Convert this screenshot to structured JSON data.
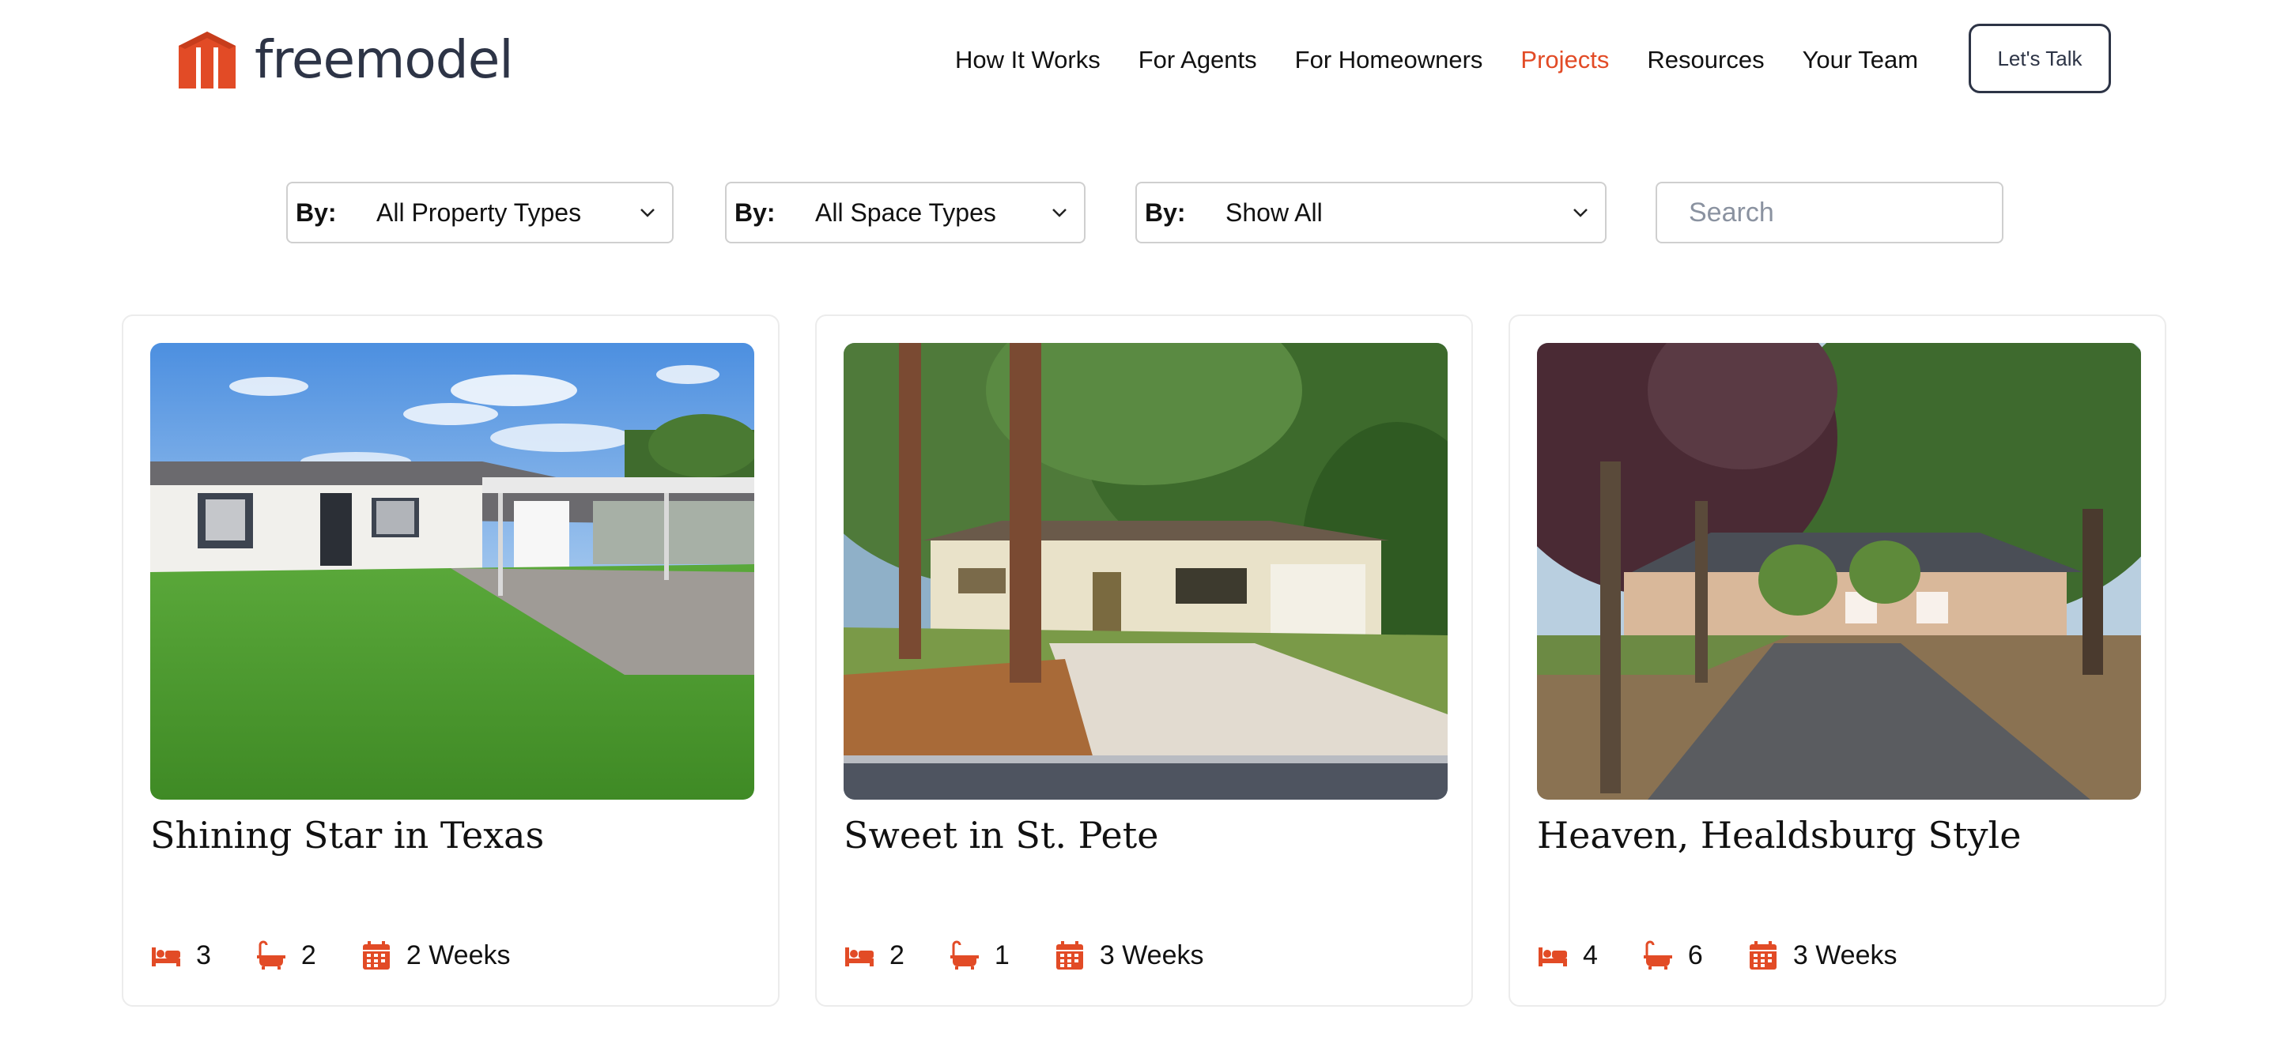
{
  "brand": {
    "name": "freemodel",
    "accent": "#e24b26",
    "dark": "#2d3446"
  },
  "nav": {
    "items": [
      {
        "label": "How It Works"
      },
      {
        "label": "For Agents"
      },
      {
        "label": "For Homeowners"
      },
      {
        "label": "Projects",
        "active": true
      },
      {
        "label": "Resources"
      },
      {
        "label": "Your Team"
      }
    ],
    "cta_label": "Let's Talk"
  },
  "filters": {
    "property": {
      "by": "By:",
      "value": "All Property Types"
    },
    "space": {
      "by": "By:",
      "value": "All Space Types"
    },
    "status": {
      "by": "By:",
      "value": "Show All"
    },
    "search_placeholder": "Search"
  },
  "projects": [
    {
      "title": "Shining Star in Texas",
      "bedrooms": "3",
      "bathrooms": "2",
      "duration": "2 Weeks"
    },
    {
      "title": "Sweet in St. Pete",
      "bedrooms": "2",
      "bathrooms": "1",
      "duration": "3 Weeks"
    },
    {
      "title": "Heaven, Healdsburg Style",
      "bedrooms": "4",
      "bathrooms": "6",
      "duration": "3 Weeks"
    }
  ],
  "icons": {
    "bed": "bed-icon",
    "bath": "bathtub-icon",
    "calendar": "calendar-icon",
    "chevron": "chevron-down-icon"
  }
}
